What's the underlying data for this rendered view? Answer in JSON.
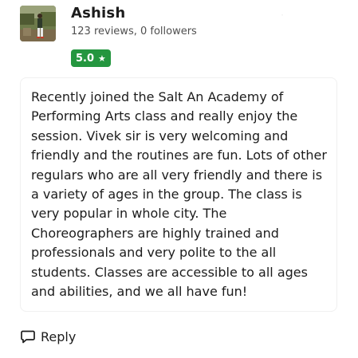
{
  "reviewer": {
    "name": "Ashish",
    "stats": "123 reviews, 0 followers",
    "avatar_icon": "user-photo"
  },
  "rating": {
    "value": "5.0",
    "star": "★",
    "color": "#24963f"
  },
  "review": {
    "text": "Recently joined the Salt An Academy of\nPerforming Arts class and really enjoy the\nsession. Vivek sir is very welcoming and\nfriendly and the routines are fun. Lots of other\nregulars who are all very friendly and there is\na variety of ages in the group. The class is\nvery popular in whole city. The\nChoreographers are highly trained and\nprofessionals and very polite to the all\nstudents. Classes are accessible to all ages\nand abilities, and we all have fun!"
  },
  "actions": {
    "reply_label": "Reply",
    "reply_icon": "comment-icon"
  }
}
